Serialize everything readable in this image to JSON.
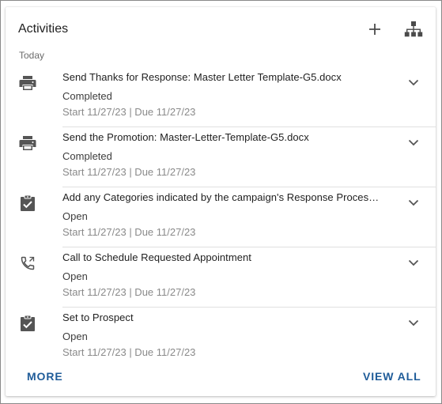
{
  "card": {
    "title": "Activities",
    "add_icon": "plus-icon",
    "hierarchy_icon": "org-chart-icon",
    "section_label": "Today"
  },
  "activities": [
    {
      "icon": "printer-icon",
      "title": "Send Thanks for Response: Master Letter Template-G5.docx",
      "status": "Completed",
      "dates": "Start 11/27/23 | Due 11/27/23"
    },
    {
      "icon": "printer-icon",
      "title": "Send the Promotion: Master-Letter-Template-G5.docx",
      "status": "Completed",
      "dates": "Start 11/27/23 | Due 11/27/23"
    },
    {
      "icon": "clipboard-check-icon",
      "title": "Add any Categories indicated by the campaign's Response Proces…",
      "status": "Open",
      "dates": "Start 11/27/23 | Due 11/27/23"
    },
    {
      "icon": "phone-callback-icon",
      "title": "Call to Schedule Requested Appointment",
      "status": "Open",
      "dates": "Start 11/27/23 | Due 11/27/23"
    },
    {
      "icon": "clipboard-check-icon",
      "title": "Set to Prospect",
      "status": "Open",
      "dates": "Start 11/27/23 | Due 11/27/23"
    }
  ],
  "footer": {
    "more_label": "MORE",
    "view_all_label": "VIEW ALL"
  },
  "colors": {
    "accent": "#1f5c99",
    "icon": "#555555"
  }
}
